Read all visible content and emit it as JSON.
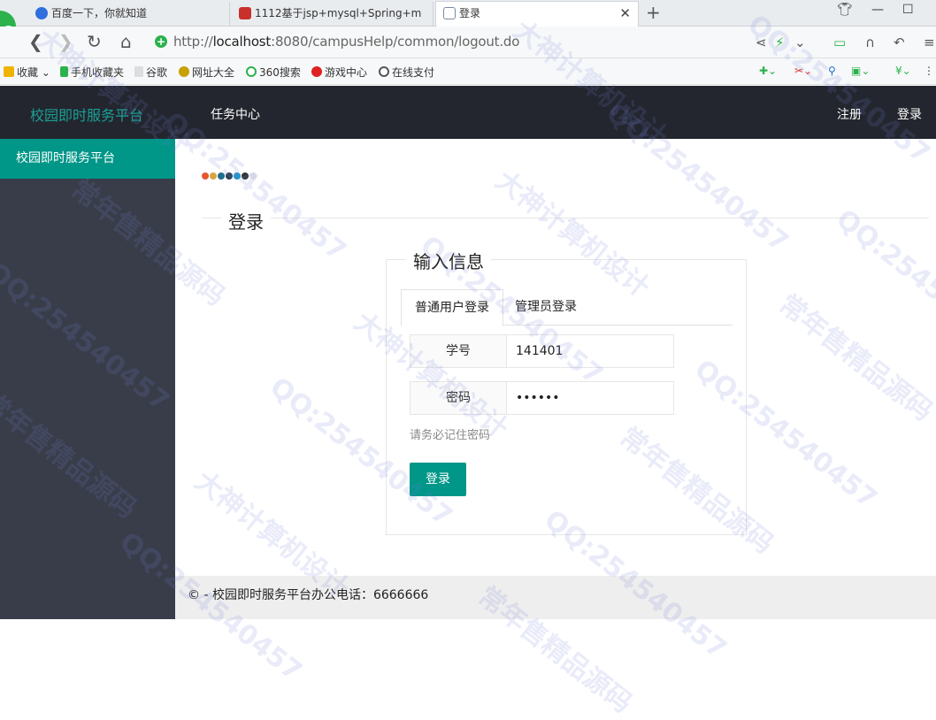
{
  "browser": {
    "tabs": [
      {
        "title": "百度一下，你就知道",
        "icon_color": "#2f6fdc"
      },
      {
        "title": "1112基于jsp+mysql+Spring+m",
        "icon_color": "#c9302c"
      },
      {
        "title": "登录",
        "icon_color": "#7a8aa0"
      }
    ],
    "url_prefix": "http://",
    "url_host": "localhost",
    "url_path": ":8080/campusHelp/common/logout.do",
    "bookmarks": [
      "收藏",
      "手机收藏夹",
      "谷歌",
      "网址大全",
      "360搜索",
      "游戏中心",
      "在线支付"
    ]
  },
  "app": {
    "brand": "校园即时服务平台",
    "nav_task_center": "任务中心",
    "nav_register": "注册",
    "nav_login": "登录",
    "sidebar_active": "校园即时服务平台",
    "dot_colors": [
      "#e4572e",
      "#d9a441",
      "#1e6f8c",
      "#2a3f55",
      "#2196c8",
      "#333333",
      "#e8e8e8"
    ],
    "section_title": "登录",
    "form": {
      "legend": "输入信息",
      "tab_user": "普通用户登录",
      "tab_admin": "管理员登录",
      "student_id_label": "学号",
      "student_id_value": "141401",
      "password_label": "密码",
      "password_value": "••••••",
      "hint": "请务必记住密码",
      "submit": "登录"
    },
    "footer": "© - 校园即时服务平台办公电话：6666666"
  },
  "watermark": {
    "texts": [
      "QQ:254540457",
      "大神计算机设计",
      "常年售精品源码"
    ],
    "color": "#7882dc"
  },
  "colors": {
    "accent": "#009688",
    "brand": "#1aa094",
    "nav_bg": "#23262e",
    "sidebar_bg": "#393d49"
  }
}
